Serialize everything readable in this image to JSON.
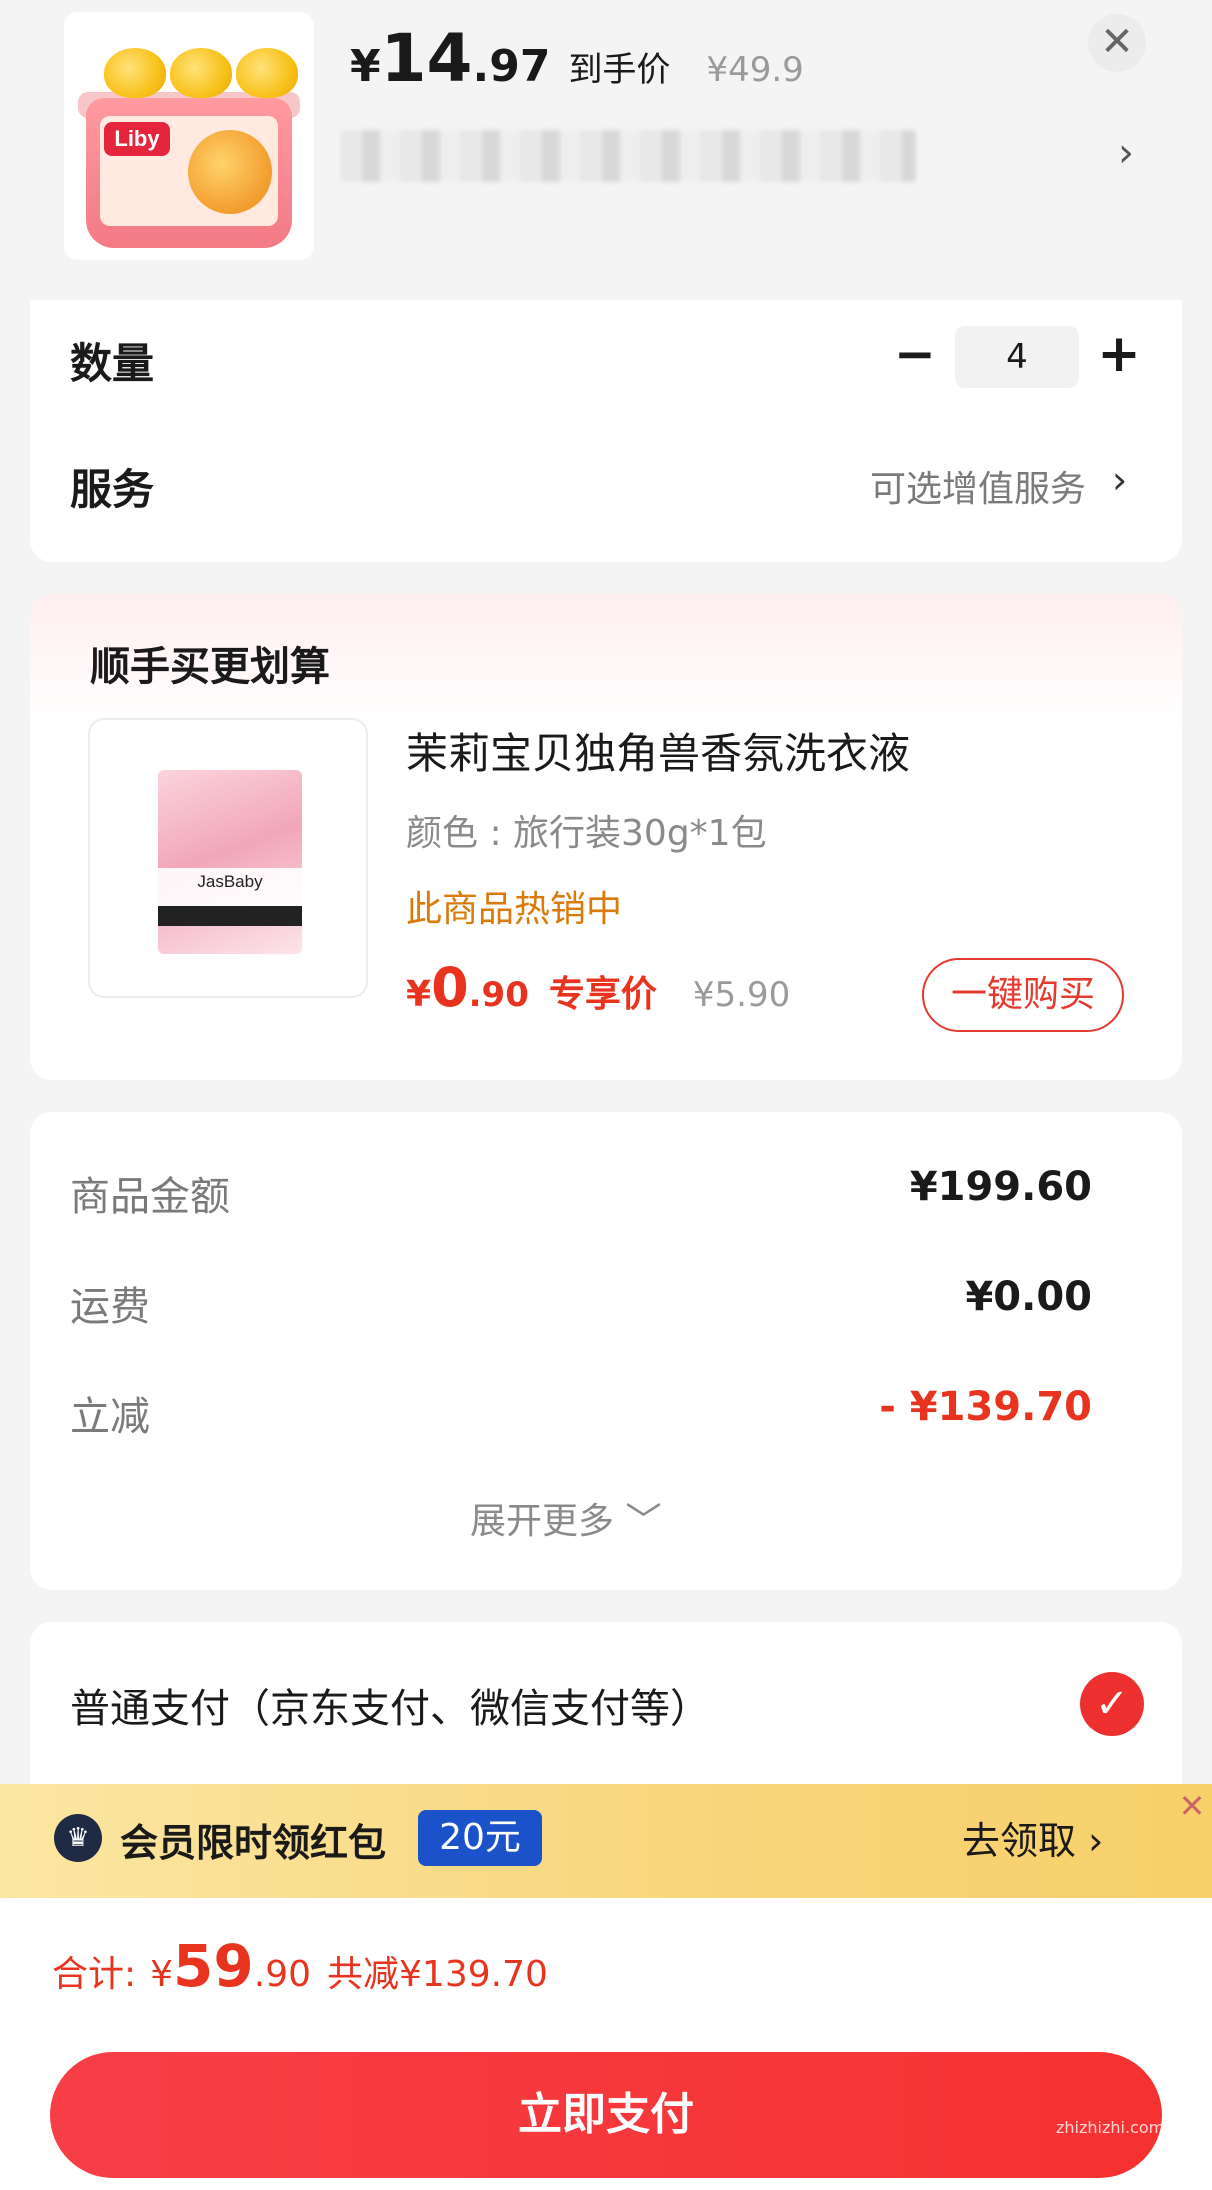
{
  "header": {
    "price_yen": "¥",
    "price_int": "14",
    "price_dec": ".97",
    "price_tag": "到手价",
    "price_original": "¥49.9",
    "product_brand": "Liby",
    "close_symbol": "✕",
    "chevron": "›"
  },
  "quantity": {
    "label": "数量",
    "minus": "−",
    "value": "4",
    "plus": "+"
  },
  "service": {
    "label": "服务",
    "value": "可选增值服务",
    "chevron": "›"
  },
  "upsell": {
    "title": "顺手买更划算",
    "thumb_brand": "JasBaby",
    "name": "茉莉宝贝独角兽香氛洗衣液",
    "spec": "颜色 : 旅行装30g*1包",
    "hot": "此商品热销中",
    "price_yen": "¥",
    "price_int": "0",
    "price_dec": ".90",
    "price_tag": "专享价",
    "price_original": "¥5.90",
    "buy_button": "一键购买"
  },
  "summary": {
    "rows": [
      {
        "label": "商品金额",
        "value": "¥199.60"
      },
      {
        "label": "运费",
        "value": "¥0.00"
      },
      {
        "label": "立减",
        "value": "- ¥139.70"
      }
    ],
    "expand": "展开更多 ﹀"
  },
  "payment": {
    "label": "普通支付（京东支付、微信支付等）",
    "check": "✓"
  },
  "banner": {
    "text": "会员限时领红包",
    "badge": "20元",
    "action": "去领取 ›",
    "close": "✕"
  },
  "footer": {
    "total_label": "合计:",
    "total_yen": "¥",
    "total_int": "59",
    "total_dec": ".90",
    "total_save": "共减¥139.70",
    "pay_button": "立即支付",
    "watermark": "zhizhizhi.com"
  },
  "colors": {
    "accent_red": "#e8341f",
    "pay_button": "#f63230",
    "hot_orange": "#d97a0b",
    "badge_blue": "#1c52c9"
  }
}
